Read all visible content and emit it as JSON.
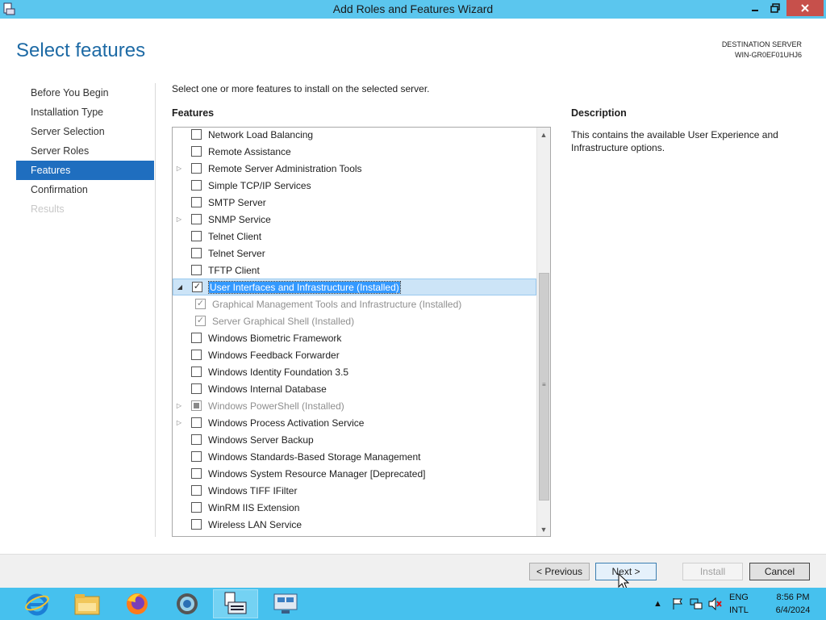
{
  "window": {
    "title": "Add Roles and Features Wizard"
  },
  "header": {
    "page_title": "Select features",
    "destination_label": "DESTINATION SERVER",
    "destination_server": "WIN-GR0EF01UHJ6"
  },
  "nav": {
    "items": [
      {
        "label": "Before You Begin"
      },
      {
        "label": "Installation Type"
      },
      {
        "label": "Server Selection"
      },
      {
        "label": "Server Roles"
      },
      {
        "label": "Features"
      },
      {
        "label": "Confirmation"
      },
      {
        "label": "Results"
      }
    ]
  },
  "main": {
    "instruction": "Select one or more features to install on the selected server.",
    "features_heading": "Features",
    "description_heading": "Description",
    "description_text": "This contains the available User Experience and Infrastructure options."
  },
  "features": [
    {
      "label": "Network Load Balancing",
      "checked": false
    },
    {
      "label": "Remote Assistance",
      "checked": false
    },
    {
      "label": "Remote Server Administration Tools",
      "checked": false,
      "expandable": true
    },
    {
      "label": "Simple TCP/IP Services",
      "checked": false
    },
    {
      "label": "SMTP Server",
      "checked": false
    },
    {
      "label": "SNMP Service",
      "checked": false,
      "expandable": true
    },
    {
      "label": "Telnet Client",
      "checked": false
    },
    {
      "label": "Telnet Server",
      "checked": false
    },
    {
      "label": "TFTP Client",
      "checked": false
    },
    {
      "label": "User Interfaces and Infrastructure (Installed)",
      "checked": true,
      "expanded": true,
      "selected": true
    },
    {
      "label": "Graphical Management Tools and Infrastructure (Installed)",
      "checked": true,
      "child": true,
      "disabled": true
    },
    {
      "label": "Server Graphical Shell (Installed)",
      "checked": true,
      "child": true,
      "disabled": true
    },
    {
      "label": "Windows Biometric Framework",
      "checked": false
    },
    {
      "label": "Windows Feedback Forwarder",
      "checked": false
    },
    {
      "label": "Windows Identity Foundation 3.5",
      "checked": false
    },
    {
      "label": "Windows Internal Database",
      "checked": false
    },
    {
      "label": "Windows PowerShell (Installed)",
      "checked": "partial",
      "expandable": true,
      "disabled": true
    },
    {
      "label": "Windows Process Activation Service",
      "checked": false,
      "expandable": true
    },
    {
      "label": "Windows Server Backup",
      "checked": false
    },
    {
      "label": "Windows Standards-Based Storage Management",
      "checked": false
    },
    {
      "label": "Windows System Resource Manager [Deprecated]",
      "checked": false
    },
    {
      "label": "Windows TIFF IFilter",
      "checked": false
    },
    {
      "label": "WinRM IIS Extension",
      "checked": false
    },
    {
      "label": "Wireless LAN Service",
      "checked": false
    }
  ],
  "footer": {
    "previous_label": "< Previous",
    "next_label": "Next >",
    "install_label": "Install",
    "cancel_label": "Cancel"
  },
  "taskbar": {
    "apps": [
      "internet-explorer-icon",
      "file-explorer-icon",
      "firefox-icon",
      "chrome-icon",
      "server-manager-icon",
      "remote-desktop-icon"
    ],
    "lang_line1": "ENG",
    "lang_line2": "INTL",
    "time": "8:56 PM",
    "date": "6/4/2024"
  },
  "colors": {
    "titlebar": "#5bc6ee",
    "accent": "#1f6ebf",
    "taskbar": "#46c1ee",
    "close": "#c7504b"
  }
}
